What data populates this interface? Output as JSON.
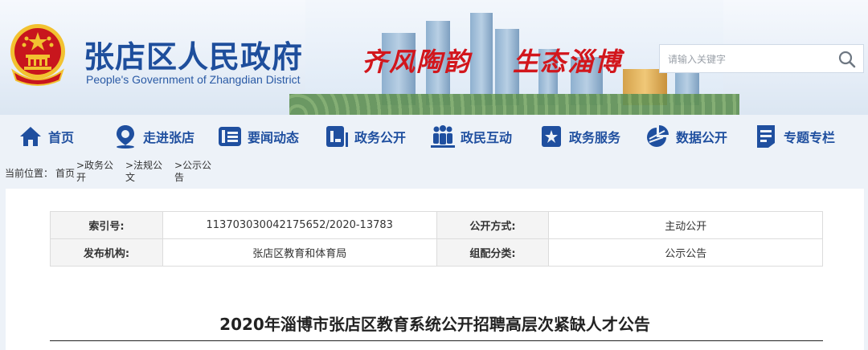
{
  "header": {
    "site_title": "张店区人民政府",
    "site_subtitle": "People's Government of Zhangdian District",
    "slogan_part1": "齐风陶韵",
    "slogan_part2": "生态淄博",
    "search": {
      "placeholder": "请输入关键字",
      "icon": "search-icon"
    }
  },
  "nav": {
    "items": [
      {
        "label": "首页",
        "icon": "home-icon"
      },
      {
        "label": "走进张店",
        "icon": "location-pin-icon"
      },
      {
        "label": "要闻动态",
        "icon": "news-list-icon"
      },
      {
        "label": "政务公开",
        "icon": "document-icon"
      },
      {
        "label": "政民互动",
        "icon": "people-icon"
      },
      {
        "label": "政务服务",
        "icon": "bookmark-star-icon"
      },
      {
        "label": "数据公开",
        "icon": "pie-chart-icon"
      },
      {
        "label": "专题专栏",
        "icon": "notepad-icon"
      }
    ]
  },
  "breadcrumb": {
    "prefix": "当前位置：",
    "home": "首页",
    "items": [
      ">政务公开",
      ">法规公文",
      ">公示公告"
    ]
  },
  "meta_table": {
    "rows": [
      {
        "k1": "索引号:",
        "v1": "113703030042175652/2020-13783",
        "k2": "公开方式:",
        "v2": "主动公开"
      },
      {
        "k1": "发布机构:",
        "v1": "张店区教育和体育局",
        "k2": "组配分类:",
        "v2": "公示公告"
      }
    ]
  },
  "article": {
    "title": "2020年淄博市张店区教育系统公开招聘高层次紧缺人才公告"
  },
  "colors": {
    "brand_blue": "#1f4f9f",
    "slogan_red": "#d2161c",
    "emblem_red": "#c8161d",
    "emblem_gold": "#f2c230"
  }
}
